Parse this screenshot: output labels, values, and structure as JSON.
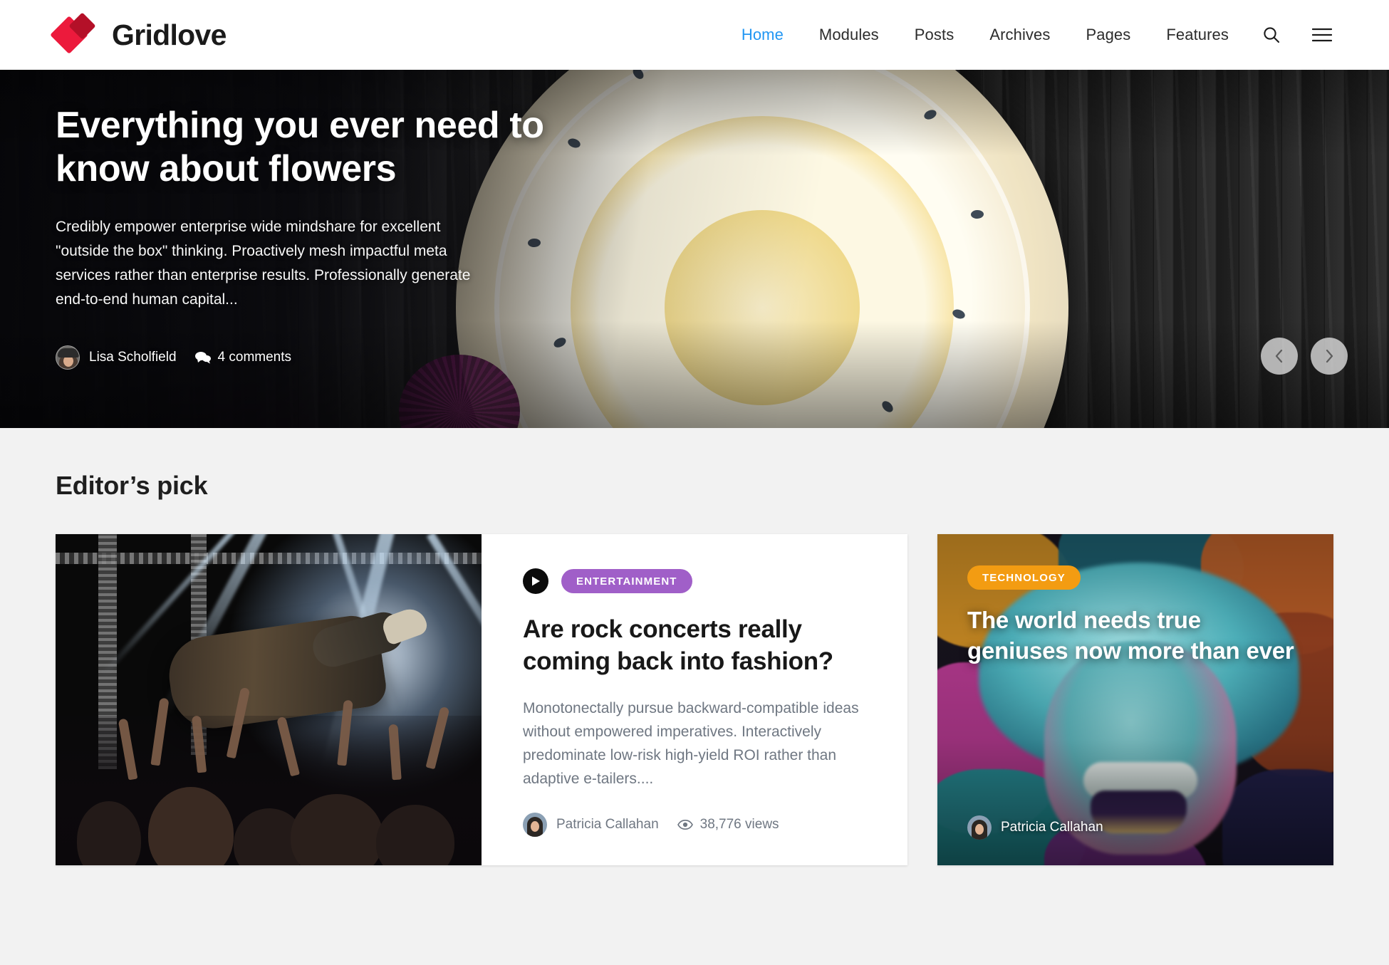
{
  "site": {
    "brand": "Gridlove",
    "brand_color": "#ec1a3c"
  },
  "nav": {
    "items": [
      {
        "label": "Home",
        "active": true
      },
      {
        "label": "Modules",
        "active": false
      },
      {
        "label": "Posts",
        "active": false
      },
      {
        "label": "Archives",
        "active": false
      },
      {
        "label": "Pages",
        "active": false
      },
      {
        "label": "Features",
        "active": false
      }
    ],
    "search_icon": "search-icon",
    "menu_icon": "hamburger-menu-icon",
    "active_color": "#2196f3"
  },
  "hero": {
    "title": "Everything you ever need to know about flowers",
    "excerpt": "Credibly empower enterprise wide mindshare for excellent \"outside the box\" thinking. Proactively mesh impactful meta services rather than enterprise results. Professionally generate end-to-end human capital...",
    "author": "Lisa Scholfield",
    "comments": "4 comments",
    "comments_icon": "comment-bubble-icon",
    "prev_label": "chevron-left-icon",
    "next_label": "chevron-right-icon"
  },
  "editors_pick": {
    "heading": "Editor’s pick",
    "featured": {
      "category": "ENTERTAINMENT",
      "category_color": "#a05fc8",
      "has_video": true,
      "video_icon": "play-icon",
      "title": "Are rock concerts really coming back into fashion?",
      "excerpt": "Monotonectally pursue backward-compatible ideas without empowered imperatives. Interactively predominate low-risk high-yield ROI rather than adaptive e-tailers....",
      "author": "Patricia Callahan",
      "views": "38,776 views",
      "views_icon": "eye-icon",
      "thumb_alt": "crowd-surfing-at-a-rock-concert"
    },
    "secondary": {
      "category": "TECHNOLOGY",
      "category_color": "#f39c12",
      "title": "The world needs true geniuses now more than ever",
      "author": "Patricia Callahan",
      "thumb_alt": "einstein-graffiti-mural"
    }
  }
}
